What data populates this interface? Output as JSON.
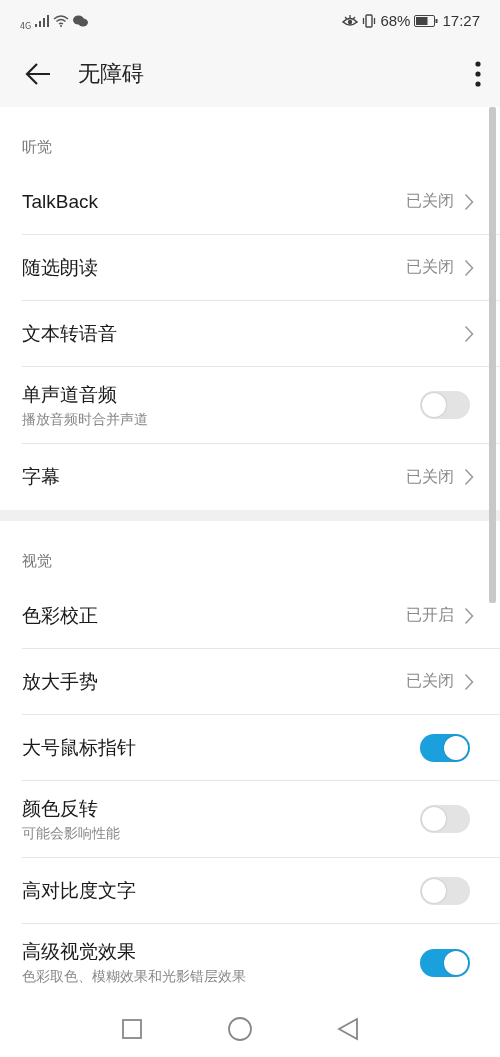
{
  "status_bar": {
    "network": "4G",
    "battery_text": "68%",
    "time": "17:27"
  },
  "toolbar": {
    "title": "无障碍"
  },
  "sections": [
    {
      "title": "听觉",
      "items": [
        {
          "kind": "link",
          "label": "TalkBack",
          "value": "已关闭"
        },
        {
          "kind": "link",
          "label": "随选朗读",
          "value": "已关闭"
        },
        {
          "kind": "link",
          "label": "文本转语音"
        },
        {
          "kind": "toggle",
          "label": "单声道音频",
          "subtitle": "播放音频时合并声道",
          "on": false
        },
        {
          "kind": "link",
          "label": "字幕",
          "value": "已关闭"
        }
      ]
    },
    {
      "title": "视觉",
      "items": [
        {
          "kind": "link",
          "label": "色彩校正",
          "value": "已开启"
        },
        {
          "kind": "link",
          "label": "放大手势",
          "value": "已关闭"
        },
        {
          "kind": "toggle",
          "label": "大号鼠标指针",
          "on": true
        },
        {
          "kind": "toggle",
          "label": "颜色反转",
          "subtitle": "可能会影响性能",
          "on": false
        },
        {
          "kind": "toggle",
          "label": "高对比度文字",
          "on": false
        },
        {
          "kind": "toggle",
          "label": "高级视觉效果",
          "subtitle": "色彩取色、模糊效果和光影错层效果",
          "on": true
        }
      ]
    }
  ]
}
